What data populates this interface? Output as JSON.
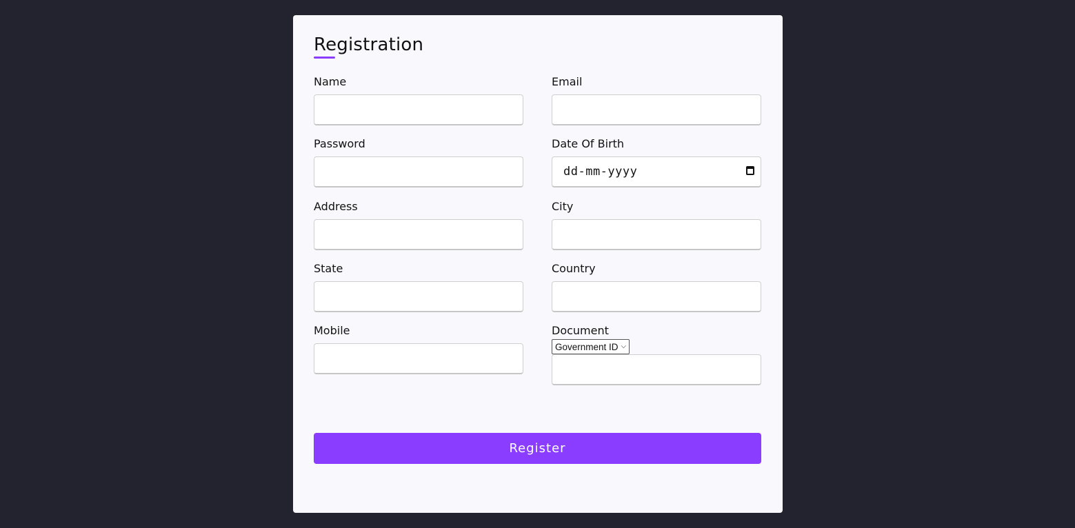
{
  "form": {
    "title": "Registration",
    "accent_color": "#8b3dff",
    "fields": {
      "name": {
        "label": "Name",
        "value": ""
      },
      "email": {
        "label": "Email",
        "value": ""
      },
      "password": {
        "label": "Password",
        "value": ""
      },
      "dob": {
        "label": "Date Of Birth",
        "placeholder": "dd-mm-yyyy",
        "icon": "calendar-icon"
      },
      "address": {
        "label": "Address",
        "value": ""
      },
      "city": {
        "label": "City",
        "value": ""
      },
      "state": {
        "label": "State",
        "value": ""
      },
      "country": {
        "label": "Country",
        "value": ""
      },
      "mobile": {
        "label": "Mobile",
        "value": ""
      },
      "document": {
        "label": "Document",
        "selected_option": "Government ID",
        "value": ""
      }
    },
    "submit_label": "Register"
  }
}
